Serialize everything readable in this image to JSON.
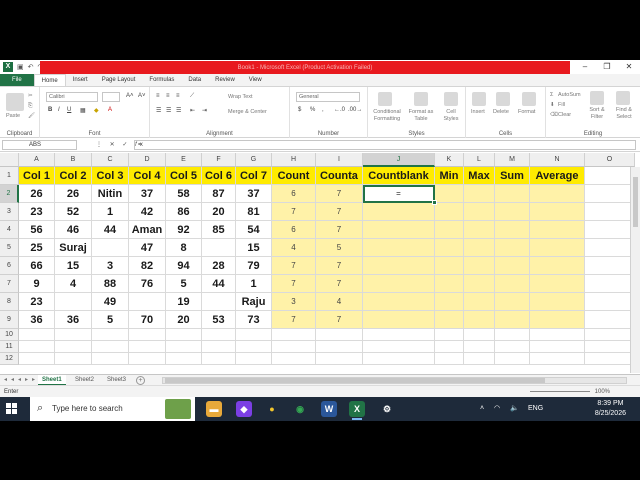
{
  "window": {
    "title": "Book1 - Microsoft Excel (Product Activation Failed)",
    "app_icon_letter": "X"
  },
  "tabs": [
    "File",
    "Home",
    "Insert",
    "Page Layout",
    "Formulas",
    "Data",
    "Review",
    "View"
  ],
  "ribbon": {
    "font_name": "Calibri",
    "number_format": "General",
    "wrap_text": "Wrap Text",
    "merge_center": "Merge & Center",
    "conditional": "Conditional Formatting",
    "format_table": "Format as Table",
    "cell_styles": "Cell Styles",
    "insert": "Insert",
    "delete": "Delete",
    "format": "Format",
    "autosum": "AutoSum",
    "fill": "Fill",
    "clear": "Clear",
    "sort_filter": "Sort & Filter",
    "find_select": "Find & Select",
    "paste": "Paste",
    "groups": [
      "Clipboard",
      "Font",
      "Alignment",
      "Number",
      "Styles",
      "Cells",
      "Editing"
    ]
  },
  "formula_bar": {
    "name_box": "ABS",
    "formula": "="
  },
  "columns": [
    "A",
    "B",
    "C",
    "D",
    "E",
    "F",
    "G",
    "H",
    "I",
    "J",
    "K",
    "L",
    "M",
    "N",
    "O"
  ],
  "rows": [
    "1",
    "2",
    "3",
    "4",
    "5",
    "6",
    "7",
    "8",
    "9",
    "10",
    "11",
    "12"
  ],
  "sheet": {
    "headers": [
      "Col 1",
      "Col 2",
      "Col 3",
      "Col 4",
      "Col 5",
      "Col 6",
      "Col 7",
      "Count",
      "Counta",
      "Countblank",
      "Min",
      "Max",
      "Sum",
      "Average"
    ],
    "data": [
      [
        "26",
        "26",
        "Nitin",
        "37",
        "58",
        "87",
        "37",
        "6",
        "7",
        "=",
        "",
        "",
        "",
        ""
      ],
      [
        "23",
        "52",
        "1",
        "42",
        "86",
        "20",
        "81",
        "7",
        "7",
        "",
        "",
        "",
        "",
        ""
      ],
      [
        "56",
        "46",
        "44",
        "Aman",
        "92",
        "85",
        "54",
        "6",
        "7",
        "",
        "",
        "",
        "",
        ""
      ],
      [
        "25",
        "Suraj",
        "",
        "47",
        "8",
        "",
        "15",
        "4",
        "5",
        "",
        "",
        "",
        "",
        ""
      ],
      [
        "66",
        "15",
        "3",
        "82",
        "94",
        "28",
        "79",
        "7",
        "7",
        "",
        "",
        "",
        "",
        ""
      ],
      [
        "9",
        "4",
        "88",
        "76",
        "5",
        "44",
        "1",
        "7",
        "7",
        "",
        "",
        "",
        "",
        ""
      ],
      [
        "23",
        "",
        "49",
        "",
        "19",
        "",
        "Raju",
        "3",
        "4",
        "",
        "",
        "",
        "",
        ""
      ],
      [
        "36",
        "36",
        "5",
        "70",
        "20",
        "53",
        "73",
        "7",
        "7",
        "",
        "",
        "",
        "",
        ""
      ]
    ]
  },
  "sheet_tabs": [
    "Sheet1",
    "Sheet2",
    "Sheet3"
  ],
  "status": {
    "mode": "Enter",
    "zoom": "100%"
  },
  "taskbar": {
    "search_placeholder": "Type here to search",
    "language": "ENG",
    "time": "8:39 PM",
    "date": "8/25/2026"
  },
  "colors": {
    "excel_green": "#217346",
    "header_yellow": "#ffeb00",
    "calc_yellow": "#fff2a8",
    "title_red": "#e8191e"
  }
}
